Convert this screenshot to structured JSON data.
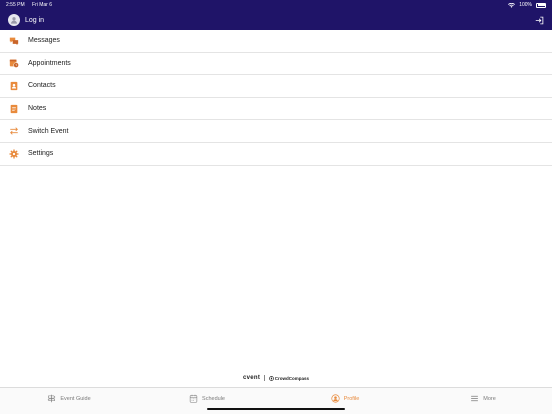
{
  "status": {
    "time": "2:55 PM",
    "date": "Fri Mar 6",
    "battery": "100%"
  },
  "header": {
    "title": "Log in"
  },
  "menu": {
    "items": [
      {
        "label": "Messages",
        "icon": "chat-bubbles-icon"
      },
      {
        "label": "Appointments",
        "icon": "calendar-clock-icon"
      },
      {
        "label": "Contacts",
        "icon": "contact-card-icon"
      },
      {
        "label": "Notes",
        "icon": "notepad-icon"
      },
      {
        "label": "Switch Event",
        "icon": "swap-arrows-icon"
      },
      {
        "label": "Settings",
        "icon": "gear-icon"
      }
    ]
  },
  "branding": {
    "primary": "cvent",
    "secondary": "CrowdCompass"
  },
  "tabs": [
    {
      "label": "Event Guide",
      "icon": "signpost-icon"
    },
    {
      "label": "Schedule",
      "icon": "calendar-icon"
    },
    {
      "label": "Profile",
      "icon": "profile-icon",
      "active": true
    },
    {
      "label": "More",
      "icon": "hamburger-icon"
    }
  ],
  "colors": {
    "header": "#1f1468",
    "accent": "#e88a3c",
    "text": "#222222"
  }
}
